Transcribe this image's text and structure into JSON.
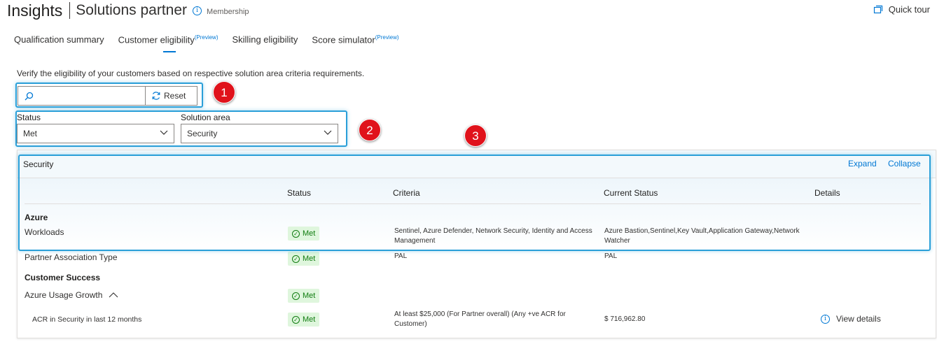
{
  "header": {
    "title": "Insights",
    "subtitle": "Solutions partner",
    "membership": "Membership",
    "quick_tour": "Quick tour"
  },
  "tabs": [
    {
      "label": "Qualification summary",
      "tag": ""
    },
    {
      "label": "Customer eligibility",
      "tag": "(Preview)"
    },
    {
      "label": "Skilling eligibility",
      "tag": ""
    },
    {
      "label": "Score simulator",
      "tag": "(Preview)"
    }
  ],
  "description": "Verify the eligibility of your customers based on respective solution area criteria requirements.",
  "search": {
    "placeholder": "",
    "reset_label": "Reset"
  },
  "filters": {
    "status_label": "Status",
    "status_value": "Met",
    "solution_label": "Solution area",
    "solution_value": "Security"
  },
  "callouts": [
    "1",
    "2",
    "3"
  ],
  "panel": {
    "title": "Security",
    "expand": "Expand",
    "collapse": "Collapse",
    "columns": [
      "Status",
      "Criteria",
      "Current Status",
      "Details"
    ],
    "groups": [
      {
        "name": "Azure",
        "rows": [
          {
            "label": "Workloads",
            "status": "Met",
            "criteria": "Sentinel, Azure Defender, Network Security, Identity and Access Management",
            "current": "Azure Bastion,Sentinel,Key Vault,Application Gateway,Network Watcher",
            "details": ""
          },
          {
            "label": "Partner Association Type",
            "status": "Met",
            "criteria": "PAL",
            "current": "PAL",
            "details": ""
          }
        ]
      },
      {
        "name": "Customer Success",
        "rows": [
          {
            "label": "Azure Usage Growth",
            "status": "Met",
            "criteria": "",
            "current": "",
            "details": ""
          },
          {
            "label": "ACR in Security in last 12 months",
            "status": "Met",
            "criteria": "At least $25,000 (For Partner overall) (Any +ve ACR for Customer)",
            "current": "$ 716,962.80",
            "details": "View details"
          }
        ]
      }
    ]
  },
  "colors": {
    "accent": "#0078d4",
    "met_bg": "#dff6dd",
    "met_text": "#107c10",
    "callout": "#e0121b",
    "highlight": "#2a9fd8"
  }
}
